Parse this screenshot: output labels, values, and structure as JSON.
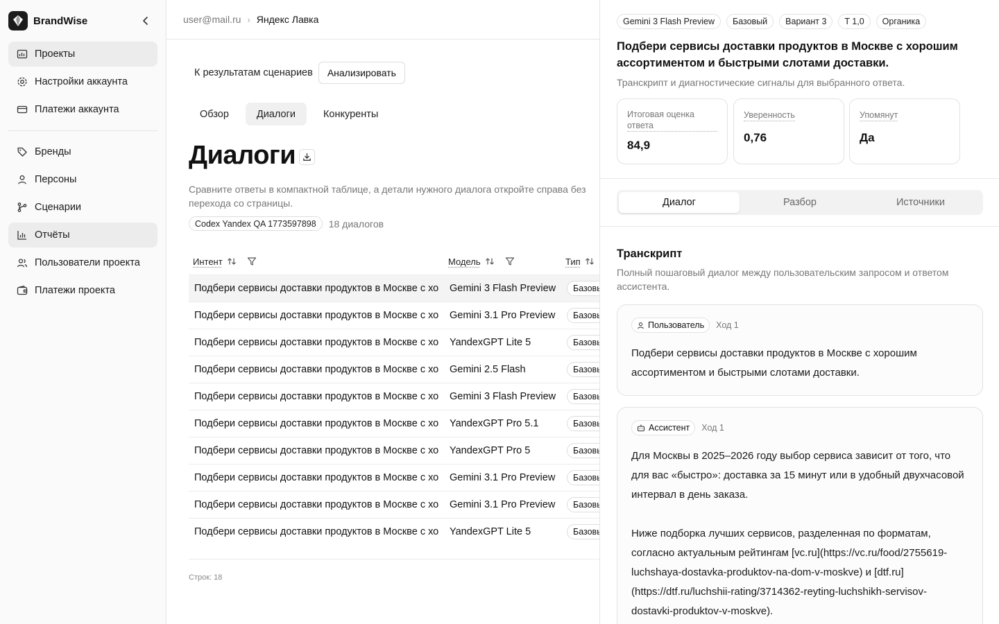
{
  "sidebar": {
    "brand": "BrandWise",
    "items_top": [
      {
        "label": "Проекты",
        "icon": "projects-icon",
        "active": true
      },
      {
        "label": "Настройки аккаунта",
        "icon": "gear-icon"
      },
      {
        "label": "Платежи аккаунта",
        "icon": "card-icon"
      }
    ],
    "items_bottom": [
      {
        "label": "Бренды",
        "icon": "tag-icon"
      },
      {
        "label": "Персоны",
        "icon": "user-icon"
      },
      {
        "label": "Сценарии",
        "icon": "branch-icon"
      },
      {
        "label": "Отчёты",
        "icon": "chart-icon",
        "active": true
      },
      {
        "label": "Пользователи проекта",
        "icon": "users-icon"
      },
      {
        "label": "Платежи проекта",
        "icon": "wallet-icon"
      }
    ]
  },
  "breadcrumb": {
    "account": "user@mail.ru",
    "project": "Яндекс Лавка"
  },
  "toolbar": {
    "back_label": "К результатам сценариев",
    "analyze_label": "Анализировать"
  },
  "tabs": [
    {
      "label": "Обзор"
    },
    {
      "label": "Диалоги",
      "active": true
    },
    {
      "label": "Конкуренты"
    }
  ],
  "page": {
    "title": "Диалоги",
    "description": "Сравните ответы в компактной таблице, а детали нужного диалога откройте справа без перехода со страницы.",
    "run_chip": "Codex Yandex QA 1773597898",
    "dialog_count": "18 диалогов"
  },
  "table": {
    "headers": {
      "intent": "Интент",
      "model": "Модель",
      "type": "Тип"
    },
    "rows": [
      {
        "intent": "Подбери сервисы доставки продуктов в Москве с хорошим ассортиментом и быстрыми слотами доставки.",
        "model": "Gemini 3 Flash Preview",
        "type": "Базовый",
        "selected": true
      },
      {
        "intent": "Подбери сервисы доставки продуктов в Москве с хорошим ассортиментом и быстрыми слотами доставки.",
        "model": "Gemini 3.1 Pro Preview",
        "type": "Базовый"
      },
      {
        "intent": "Подбери сервисы доставки продуктов в Москве с хорошим ассортиментом и быстрыми слотами доставки.",
        "model": "YandexGPT Lite 5",
        "type": "Базовый"
      },
      {
        "intent": "Подбери сервисы доставки продуктов в Москве с хорошим ассортиментом и быстрыми слотами доставки.",
        "model": "Gemini 2.5 Flash",
        "type": "Базовый"
      },
      {
        "intent": "Подбери сервисы доставки продуктов в Москве с хорошим ассортиментом и быстрыми слотами доставки.",
        "model": "Gemini 3 Flash Preview",
        "type": "Базовый"
      },
      {
        "intent": "Подбери сервисы доставки продуктов в Москве с хорошим ассортиментом и быстрыми слотами доставки.",
        "model": "YandexGPT Pro 5.1",
        "type": "Базовый"
      },
      {
        "intent": "Подбери сервисы доставки продуктов в Москве с хорошим ассортиментом и быстрыми слотами доставки.",
        "model": "YandexGPT Pro 5",
        "type": "Базовый"
      },
      {
        "intent": "Подбери сервисы доставки продуктов в Москве с хорошим ассортиментом и быстрыми слотами доставки.",
        "model": "Gemini 3.1 Pro Preview",
        "type": "Базовый"
      },
      {
        "intent": "Подбери сервисы доставки продуктов в Москве с хорошим ассортиментом и быстрыми слотами доставки.",
        "model": "Gemini 3.1 Pro Preview",
        "type": "Базовый"
      },
      {
        "intent": "Подбери сервисы доставки продуктов в Москве с хорошим ассортиментом и быстрыми слотами доставки.",
        "model": "YandexGPT Lite 5",
        "type": "Базовый"
      }
    ],
    "row_count": "Строк: 18"
  },
  "panel": {
    "badges": [
      "Gemini 3 Flash Preview",
      "Базовый",
      "Вариант 3",
      "T 1,0",
      "Органика"
    ],
    "title": "Подбери сервисы доставки продуктов в Москве с хорошим ассортиментом и быстрыми слотами доставки.",
    "subtitle": "Транскрипт и диагностические сигналы для выбранного ответа.",
    "metrics": [
      {
        "label": "Итоговая оценка ответа",
        "value": "84,9"
      },
      {
        "label": "Уверенность",
        "value": "0,76"
      },
      {
        "label": "Упомянут",
        "value": "Да"
      }
    ],
    "tabs": [
      {
        "label": "Диалог",
        "active": true
      },
      {
        "label": "Разбор"
      },
      {
        "label": "Источники"
      }
    ],
    "transcript_title": "Транскрипт",
    "transcript_desc": "Полный пошаговый диалог между пользовательским запросом и ответом ассистента.",
    "messages": [
      {
        "role": "Пользователь",
        "turn": "Ход 1",
        "paragraphs": [
          "Подбери сервисы доставки продуктов в Москве с хорошим ассортиментом и быстрыми слотами доставки."
        ]
      },
      {
        "role": "Ассистент",
        "turn": "Ход 1",
        "paragraphs": [
          "Для Москвы в 2025–2026 году выбор сервиса зависит от того, что для вас «быстро»: доставка за 15 минут или в удобный двухчасовой интервал в день заказа.",
          "Ниже подборка лучших сервисов, разделенная по форматам, согласно актуальным рейтингам [vc.ru](https://vc.ru/food/2755619-luchshaya-dostavka-produktov-na-dom-v-moskve) и [dtf.ru](https://dtf.ru/luchshii-rating/3714362-reyting-luchshikh-servisov-dostavki-produktov-v-moskve)."
        ]
      }
    ]
  }
}
